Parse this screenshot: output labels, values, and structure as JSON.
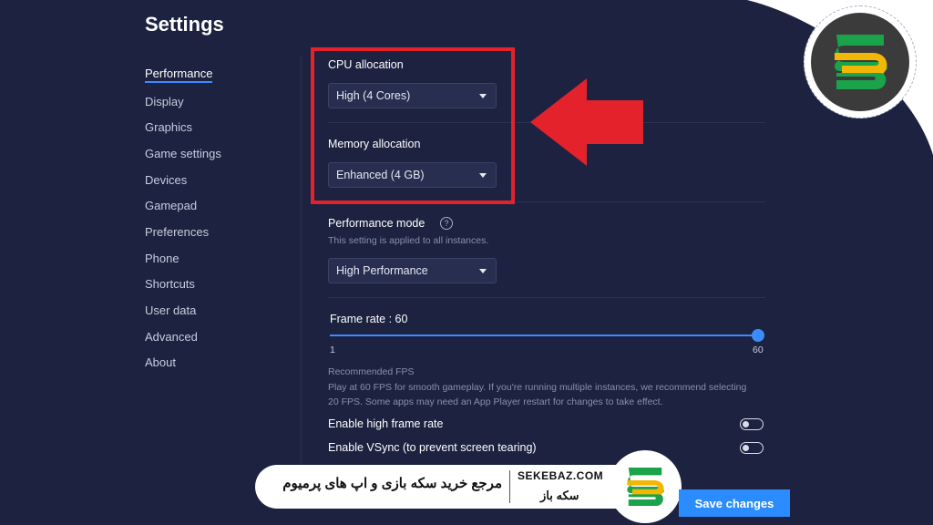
{
  "page_title": "Settings",
  "sidebar": {
    "items": [
      {
        "label": "Performance"
      },
      {
        "label": "Display"
      },
      {
        "label": "Graphics"
      },
      {
        "label": "Game settings"
      },
      {
        "label": "Devices"
      },
      {
        "label": "Gamepad"
      },
      {
        "label": "Preferences"
      },
      {
        "label": "Phone"
      },
      {
        "label": "Shortcuts"
      },
      {
        "label": "User data"
      },
      {
        "label": "Advanced"
      },
      {
        "label": "About"
      }
    ],
    "active": "Performance"
  },
  "cpu": {
    "label": "CPU allocation",
    "value": "High (4 Cores)"
  },
  "memory": {
    "label": "Memory allocation",
    "value": "Enhanced (4 GB)"
  },
  "perf_mode": {
    "label": "Performance mode",
    "hint": "This setting is applied to all instances.",
    "value": "High Performance"
  },
  "frame_rate": {
    "label": "Frame rate : 60",
    "min_label": "1",
    "max_label": "60",
    "value": 60,
    "min": 1,
    "max": 60
  },
  "recommended": {
    "title": "Recommended FPS",
    "text": "Play at 60 FPS for smooth gameplay. If you're running multiple instances, we recommend selecting 20 FPS. Some apps may need an App Player restart for changes to take effect."
  },
  "toggles": {
    "high_frame_rate": {
      "label": "Enable high frame rate",
      "on": false
    },
    "vsync": {
      "label": "Enable VSync (to prevent screen tearing)",
      "on": false
    }
  },
  "save_label": "Save changes",
  "banner": {
    "persian_text": "مرجع خرید سکه بازی و اپ های پرمیوم",
    "domain": "SEKEBAZ.COM",
    "name": "سکه باز"
  },
  "colors": {
    "background": "#1c2240",
    "accent": "#3b8cff",
    "highlight": "#e3222b",
    "logo_green": "#1aa34a",
    "logo_yellow": "#f2b705"
  }
}
